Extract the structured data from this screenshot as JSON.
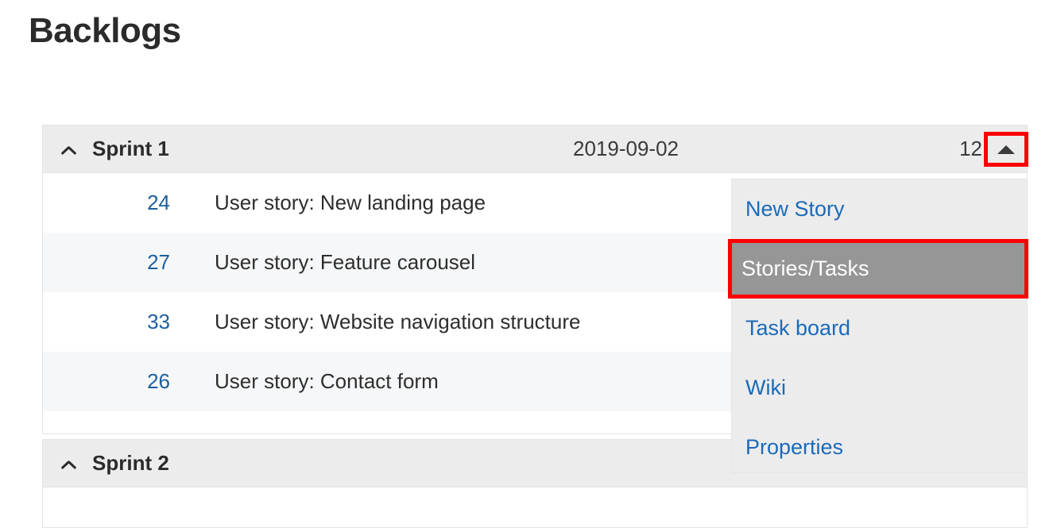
{
  "page": {
    "title": "Backlogs"
  },
  "colors": {
    "link_blue": "#1c5f9e",
    "menu_link_blue": "#1c6ab8",
    "annotation_red": "#fb0000",
    "header_gray": "#ececec",
    "selected_gray": "#969696",
    "row_alt_gray": "#f6f7f8",
    "text_dark": "#2b2b2b"
  },
  "sprints": [
    {
      "name": "Sprint 1",
      "date": "2019-09-02",
      "count": "12",
      "collapse_icon": "chevron-up-icon",
      "menu_icon": "caret-up-icon",
      "stories": [
        {
          "id": "24",
          "title": "User story: New landing page"
        },
        {
          "id": "27",
          "title": "User story: Feature carousel"
        },
        {
          "id": "33",
          "title": "User story: Website navigation structure"
        },
        {
          "id": "26",
          "title": "User story: Contact form"
        }
      ]
    },
    {
      "name": "Sprint 2",
      "date": "",
      "count": "",
      "collapse_icon": "chevron-up-icon",
      "stories": []
    }
  ],
  "dropdown": {
    "items": [
      {
        "label": "New Story",
        "selected": false
      },
      {
        "label": "Stories/Tasks",
        "selected": true
      },
      {
        "label": "Task board",
        "selected": false
      },
      {
        "label": "Wiki",
        "selected": false
      },
      {
        "label": "Properties",
        "selected": false
      }
    ]
  }
}
